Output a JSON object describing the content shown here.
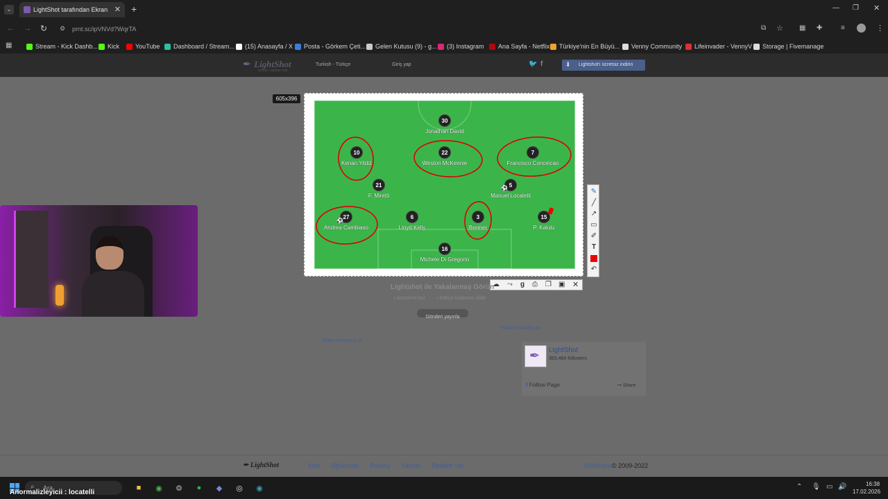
{
  "browser": {
    "tab_title": "LightShot tarafından Ekran Gör...",
    "url": "prnt.sc/ipVNVd?WqrTA",
    "bookmarks": [
      {
        "label": "Stream - Kick Dashb...",
        "color": "#53fc18"
      },
      {
        "label": "Kick",
        "color": "#53fc18"
      },
      {
        "label": "YouTube",
        "color": "#ff0000"
      },
      {
        "label": "Dashboard / Stream...",
        "color": "#2fbf9f"
      },
      {
        "label": "(15) Anasayfa / X",
        "color": "#ffffff"
      },
      {
        "label": "Posta - Görkem Çeti...",
        "color": "#3b7ddd"
      },
      {
        "label": "Gelen Kutusu (9) - g...",
        "color": "#cccccc"
      },
      {
        "label": "(3) Instagram",
        "color": "#d62976"
      },
      {
        "label": "Ana Sayfa - Netflix",
        "color": "#b00710"
      },
      {
        "label": "Türkiye'nin En Büyü...",
        "color": "#f0a030"
      },
      {
        "label": "Venny Community",
        "color": "#dddddd"
      },
      {
        "label": "Lifeinvader - VennyV",
        "color": "#e03030"
      },
      {
        "label": "Storage | Fivemanage",
        "color": "#dddddd"
      }
    ]
  },
  "site_header": {
    "logo": "LightShot",
    "logo_sub": "screen capture tool",
    "language": "Turkish - Türkçe",
    "login": "Giriş yap",
    "download_button": "Lightshot'ı ücretsiz indirin"
  },
  "capture": {
    "size_label": "605x396",
    "players": [
      {
        "number": "30",
        "name": "Jonathan David"
      },
      {
        "number": "10",
        "name": "Kenan Yildiz"
      },
      {
        "number": "22",
        "name": "Weston McKennie"
      },
      {
        "number": "7",
        "name": "Francisco Conceicao"
      },
      {
        "number": "21",
        "name": "F. Miretti"
      },
      {
        "number": "5",
        "name": "Manuel Locatelli"
      },
      {
        "number": "27",
        "name": "Andrea Cambiaso"
      },
      {
        "number": "6",
        "name": "Lloyd Kelly"
      },
      {
        "number": "3",
        "name": "Bremer"
      },
      {
        "number": "15",
        "name": "P. Kalulu"
      },
      {
        "number": "16",
        "name": "Michele Di Gregorio"
      }
    ]
  },
  "page_content": {
    "caption": "Lightshot ile Yakalanmış Görün",
    "similar": "benzerini bul",
    "report_image": "kötüye kullanımı bildir",
    "tweet": "Gönderi yayınla",
    "report_ad_1": "Report misleading ad",
    "report_ad_2": "Report misleading ad",
    "fb_name": "LightShot",
    "fb_followers": "383,464 followers",
    "fb_follow": "Follow Page",
    "fb_share": "Share"
  },
  "footer": {
    "logo": "LightShot",
    "links": [
      "İndir",
      "Öğreticiler",
      "Privacy",
      "Yardım",
      "Reklam Ver"
    ],
    "brand": "Skillbrains",
    "copyright": "© 2009-2022"
  },
  "taskbar": {
    "search": "Ara",
    "overlay": "Anormalizleyicii : locatelli",
    "time": "16:38",
    "date": "17.02.2026"
  }
}
